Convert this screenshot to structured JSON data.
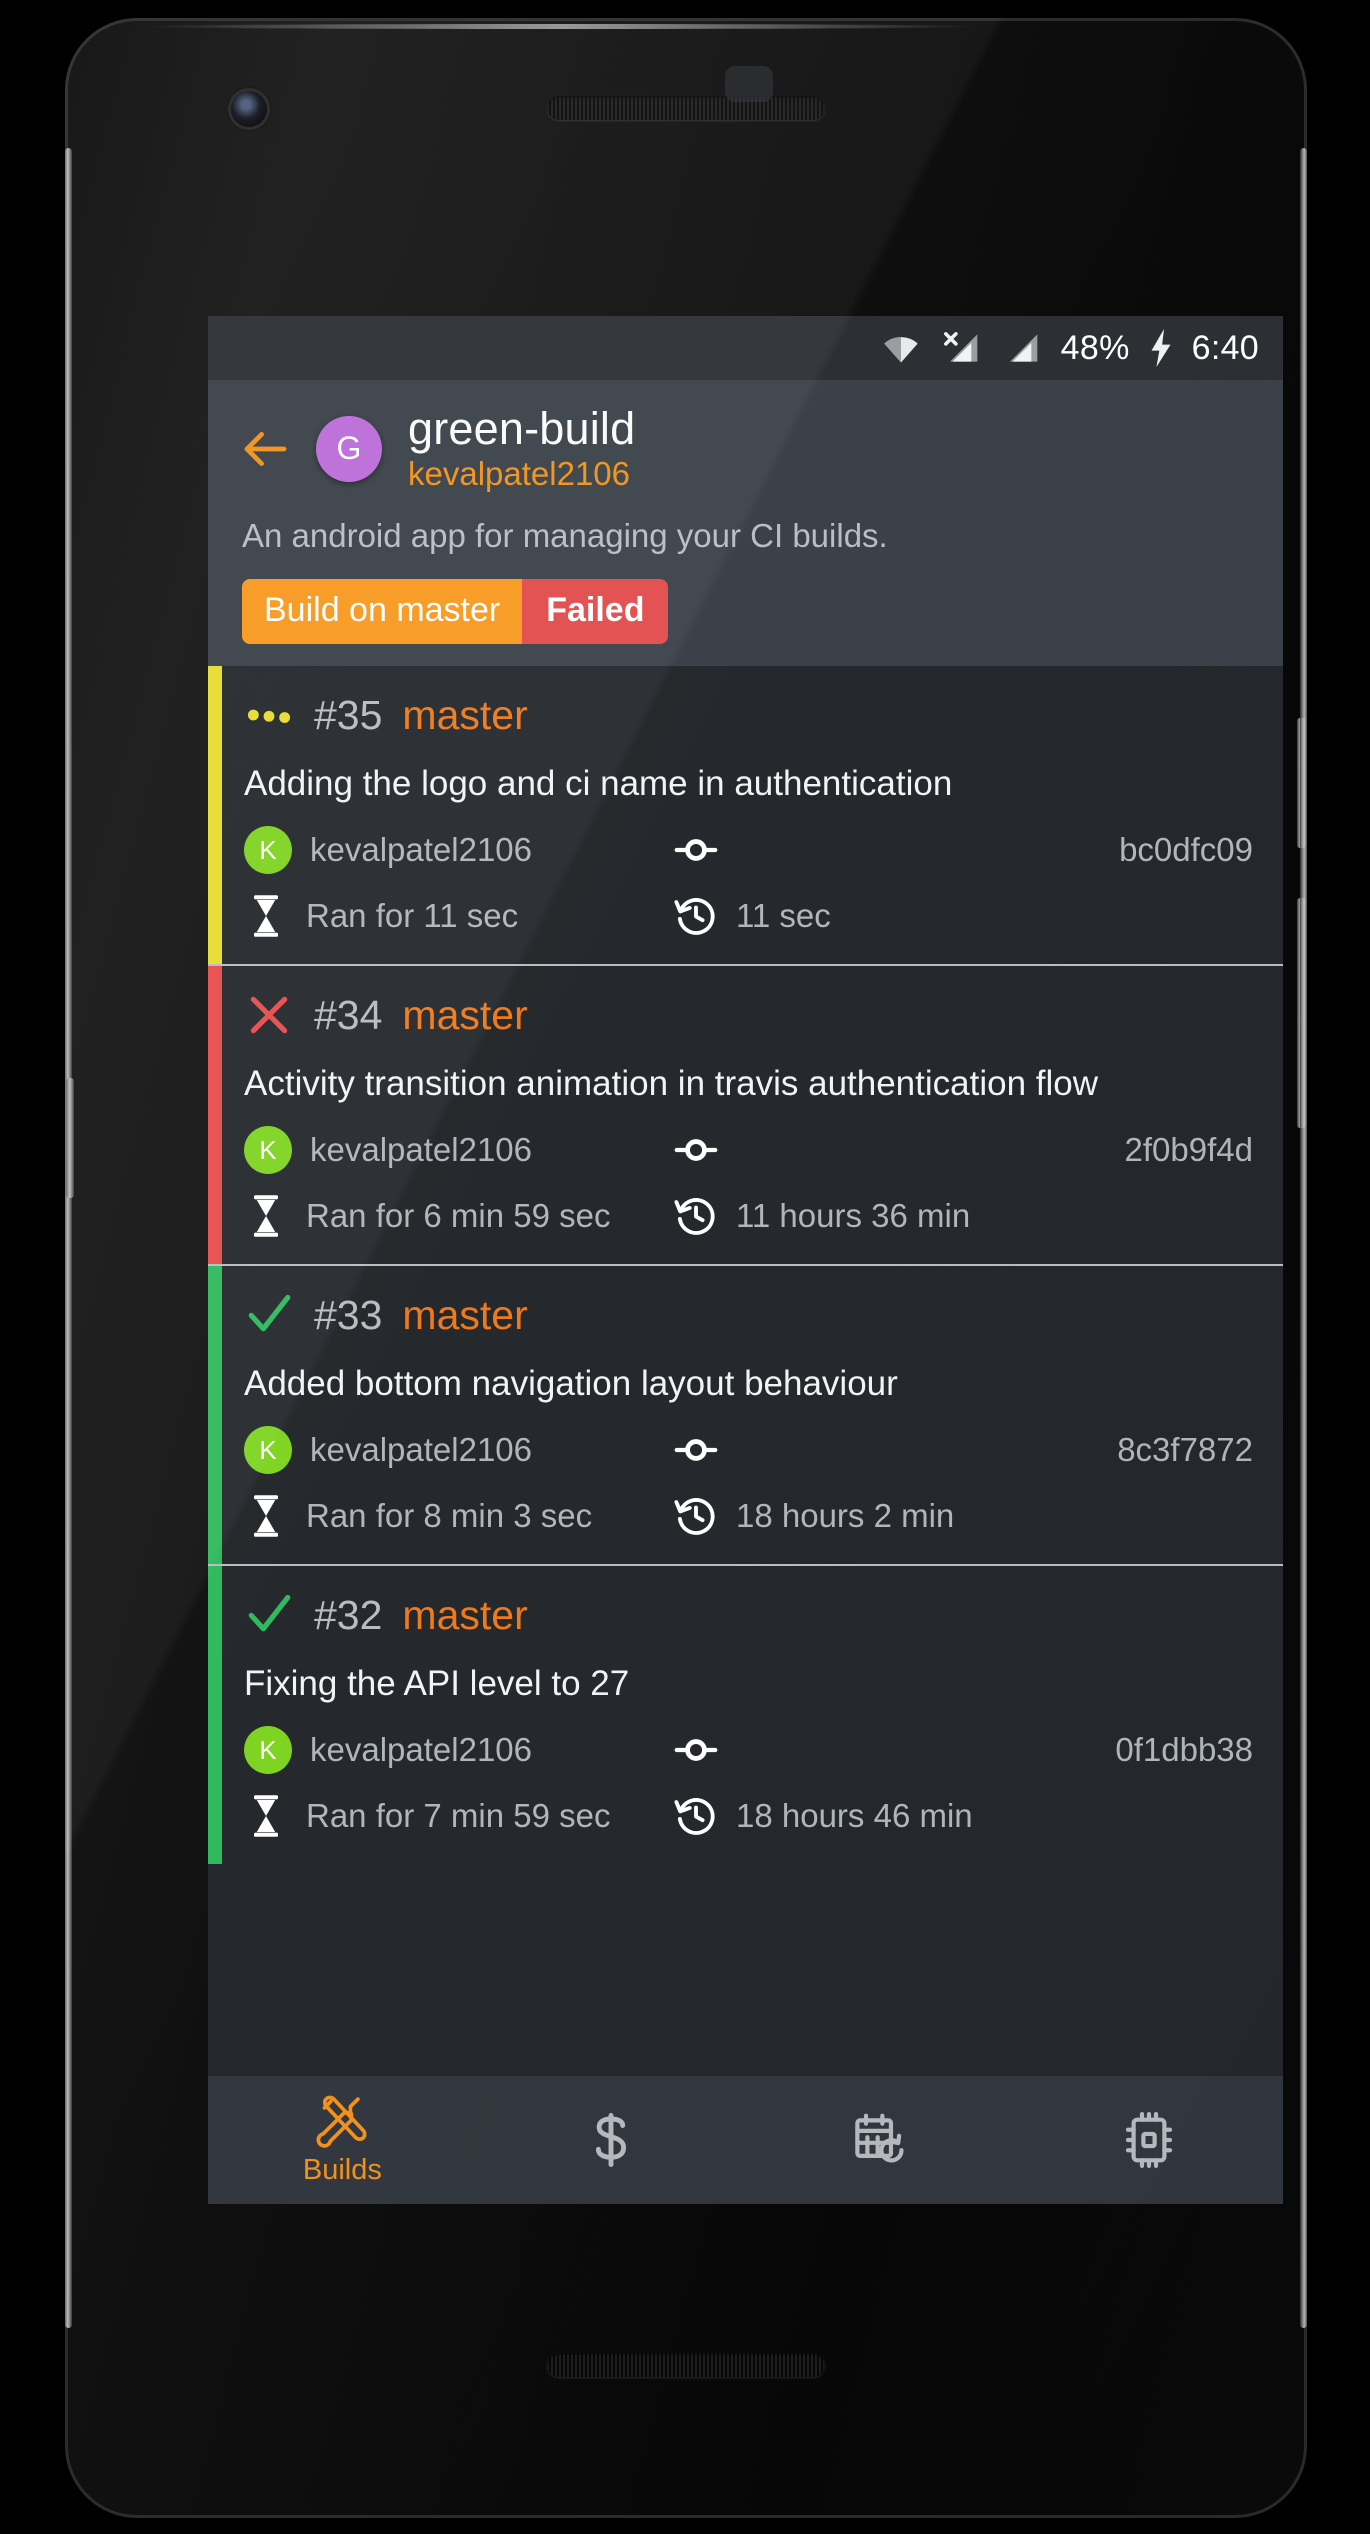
{
  "statusbar": {
    "icons": [
      "wifi-icon",
      "signal-no-sim-icon",
      "signal-icon",
      "charging-bolt-icon"
    ],
    "battery": "48%",
    "time": "6:40"
  },
  "appbar": {
    "back_icon": "back-arrow-icon",
    "avatar_letter": "G",
    "avatar_color": "#bb6bd9",
    "repo_name": "green-build",
    "repo_owner": "kevalpatel2106",
    "description": "An android app for managing your CI builds.",
    "badge": {
      "left_label": "Build on master",
      "left_color": "#f8981d",
      "right_label": "Failed",
      "right_color": "#e24a4a"
    }
  },
  "builds": [
    {
      "status": "running",
      "status_icon": "ellipsis-running-icon",
      "accent": "#e8dc2e",
      "number": "#35",
      "branch": "master",
      "message": "Adding the logo and ci name in authentication",
      "author": "kevalpatel2106",
      "author_initial": "K",
      "commit_icon": "git-commit-icon",
      "commit_hash": "bc0dfc09",
      "duration_icon": "hourglass-icon",
      "duration": "Ran for 11 sec",
      "elapsed_icon": "history-icon",
      "elapsed": "11 sec"
    },
    {
      "status": "failed",
      "status_icon": "cross-failed-icon",
      "accent": "#e74c4c",
      "number": "#34",
      "branch": "master",
      "message": "Activity transition animation in travis authentication flow",
      "author": "kevalpatel2106",
      "author_initial": "K",
      "commit_icon": "git-commit-icon",
      "commit_hash": "2f0b9f4d",
      "duration_icon": "hourglass-icon",
      "duration": "Ran for 6 min 59 sec",
      "elapsed_icon": "history-icon",
      "elapsed": "11 hours 36 min"
    },
    {
      "status": "passed",
      "status_icon": "check-passed-icon",
      "accent": "#2eb85c",
      "number": "#33",
      "branch": "master",
      "message": "Added bottom navigation layout behaviour",
      "author": "kevalpatel2106",
      "author_initial": "K",
      "commit_icon": "git-commit-icon",
      "commit_hash": "8c3f7872",
      "duration_icon": "hourglass-icon",
      "duration": "Ran for 8 min 3 sec",
      "elapsed_icon": "history-icon",
      "elapsed": "18 hours 2 min"
    },
    {
      "status": "passed",
      "status_icon": "check-passed-icon",
      "accent": "#2eb85c",
      "number": "#32",
      "branch": "master",
      "message": "Fixing the API level to 27",
      "author": "kevalpatel2106",
      "author_initial": "K",
      "commit_icon": "git-commit-icon",
      "commit_hash": "0f1dbb38",
      "duration_icon": "hourglass-icon",
      "duration": "Ran for 7 min 59 sec",
      "elapsed_icon": "history-icon",
      "elapsed": "18 hours 46 min"
    }
  ],
  "bottomnav": {
    "active_color": "#f0911a",
    "inactive_color": "#b5b9bd",
    "items": [
      {
        "icon": "tools-builds-icon",
        "label": "Builds",
        "active": true
      },
      {
        "icon": "dollar-cost-icon",
        "label": "",
        "active": false
      },
      {
        "icon": "calendar-refresh-icon",
        "label": "",
        "active": false
      },
      {
        "icon": "chip-cpu-icon",
        "label": "",
        "active": false
      }
    ]
  }
}
